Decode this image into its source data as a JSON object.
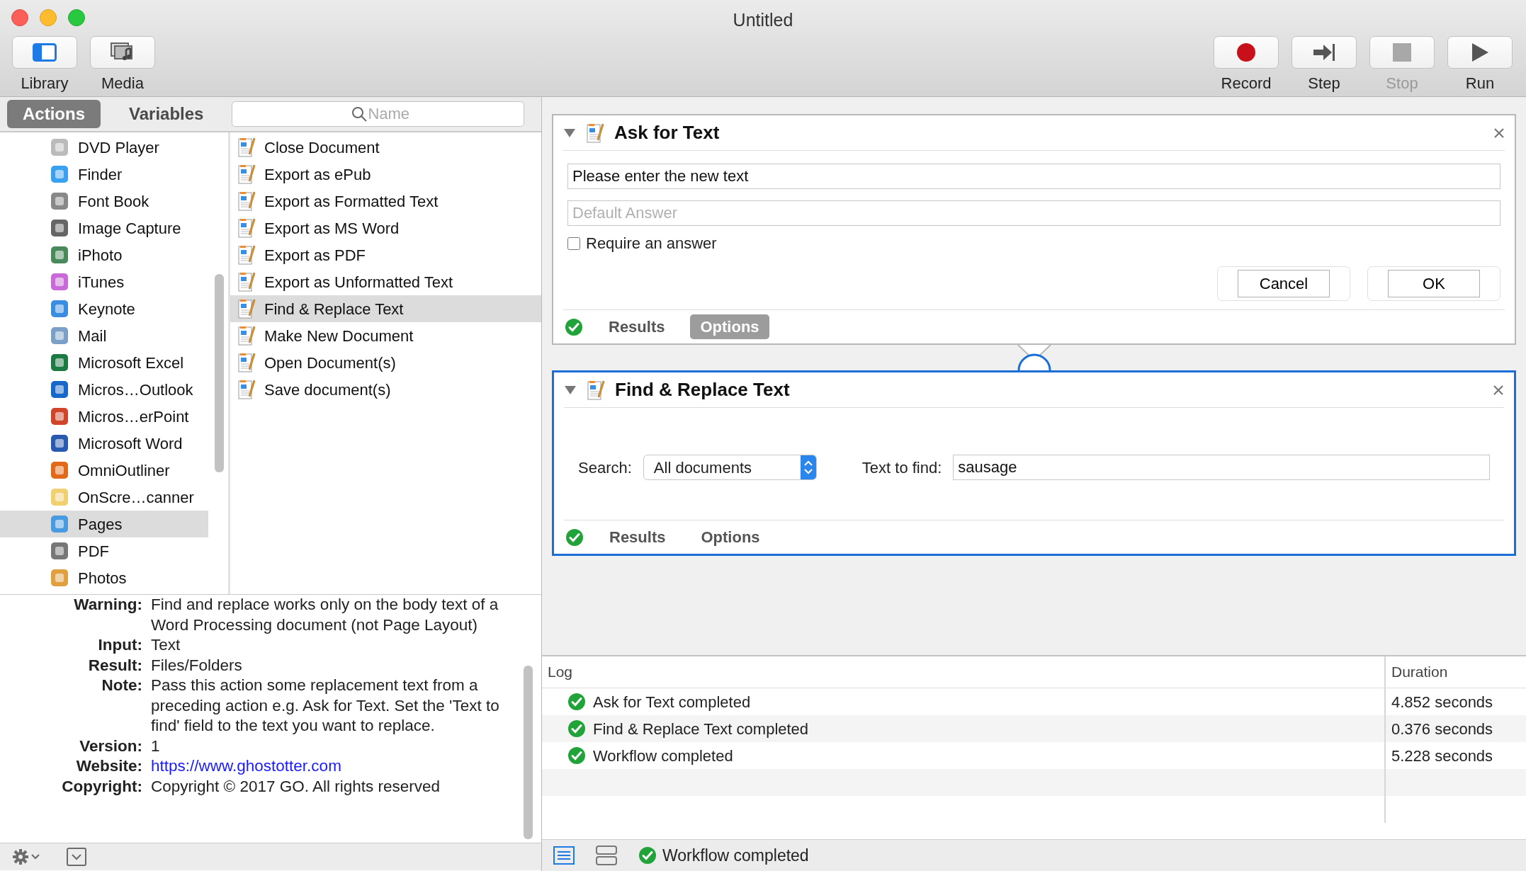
{
  "window": {
    "title": "Untitled"
  },
  "toolbar_left": [
    {
      "label": "Library",
      "kind": "library"
    },
    {
      "label": "Media",
      "kind": "media"
    }
  ],
  "toolbar_right": [
    {
      "label": "Record",
      "kind": "record",
      "disabled": false
    },
    {
      "label": "Step",
      "kind": "step",
      "disabled": false
    },
    {
      "label": "Stop",
      "kind": "stop",
      "disabled": true
    },
    {
      "label": "Run",
      "kind": "run",
      "disabled": false
    }
  ],
  "library_tabs": [
    {
      "label": "Actions",
      "selected": true
    },
    {
      "label": "Variables",
      "selected": false
    }
  ],
  "search": {
    "placeholder": "Name"
  },
  "categories": [
    {
      "label": "DVD Player",
      "selected": false
    },
    {
      "label": "Finder",
      "selected": false
    },
    {
      "label": "Font Book",
      "selected": false
    },
    {
      "label": "Image Capture",
      "selected": false
    },
    {
      "label": "iPhoto",
      "selected": false
    },
    {
      "label": "iTunes",
      "selected": false
    },
    {
      "label": "Keynote",
      "selected": false
    },
    {
      "label": "Mail",
      "selected": false
    },
    {
      "label": "Microsoft Excel",
      "selected": false
    },
    {
      "label": "Micros…Outlook",
      "selected": false
    },
    {
      "label": "Micros…erPoint",
      "selected": false
    },
    {
      "label": "Microsoft Word",
      "selected": false
    },
    {
      "label": "OmniOutliner",
      "selected": false
    },
    {
      "label": "OnScre…canner",
      "selected": false
    },
    {
      "label": "Pages",
      "selected": true
    },
    {
      "label": "PDF",
      "selected": false
    },
    {
      "label": "Photos",
      "selected": false
    }
  ],
  "actions": [
    {
      "label": "Close Document",
      "selected": false
    },
    {
      "label": "Export as ePub",
      "selected": false
    },
    {
      "label": "Export as Formatted Text",
      "selected": false
    },
    {
      "label": "Export as MS Word",
      "selected": false
    },
    {
      "label": "Export as PDF",
      "selected": false
    },
    {
      "label": "Export as Unformatted Text",
      "selected": false
    },
    {
      "label": "Find & Replace Text",
      "selected": true
    },
    {
      "label": "Make New Document",
      "selected": false
    },
    {
      "label": "Open Document(s)",
      "selected": false
    },
    {
      "label": "Save document(s)",
      "selected": false
    }
  ],
  "description": [
    {
      "label": "Warning:",
      "value": "Find and replace works only on the body text of a Word Processing document (not Page Layout)"
    },
    {
      "label": "Input:",
      "value": "Text"
    },
    {
      "label": "Result:",
      "value": "Files/Folders"
    },
    {
      "label": "Note:",
      "value": "Pass this action some replacement text from a preceding action e.g. Ask for Text. Set the 'Text to find' field to the text you want to replace."
    },
    {
      "label": "Version:",
      "value": "1"
    },
    {
      "label": "Website:",
      "value": "https://www.ghostotter.com",
      "kind": "link"
    },
    {
      "label": "Copyright:",
      "value": "Copyright © 2017 GO. All rights reserved"
    }
  ],
  "workflow": [
    {
      "kind": "ask_text",
      "title": "Ask for Text",
      "selected": false,
      "prompt": "Please enter the new text",
      "answer": {
        "placeholder": "Default Answer"
      },
      "checkbox": {
        "label": "Require an answer",
        "checked": false
      },
      "buttons": [
        "Cancel",
        "OK"
      ],
      "tabs": [
        {
          "label": "Results",
          "selected": false
        },
        {
          "label": "Options",
          "selected": true
        }
      ]
    },
    {
      "kind": "find_replace",
      "title": "Find & Replace Text",
      "selected": true,
      "search_label": "Search:",
      "search_value": "All documents",
      "find_label": "Text to find:",
      "find_value": "sausage",
      "tabs": [
        {
          "label": "Results",
          "selected": false
        },
        {
          "label": "Options",
          "selected": false
        }
      ]
    }
  ],
  "log": {
    "columns": [
      "Log",
      "Duration"
    ],
    "rows": [
      {
        "message": "Ask for Text completed",
        "duration": "4.852 seconds"
      },
      {
        "message": "Find & Replace Text completed",
        "duration": "0.376 seconds"
      },
      {
        "message": "Workflow completed",
        "duration": "5.228 seconds"
      }
    ]
  },
  "view_modes": [
    {
      "kind": "list",
      "selected": true
    },
    {
      "kind": "split",
      "selected": false
    }
  ],
  "status": {
    "message": "Workflow completed"
  }
}
